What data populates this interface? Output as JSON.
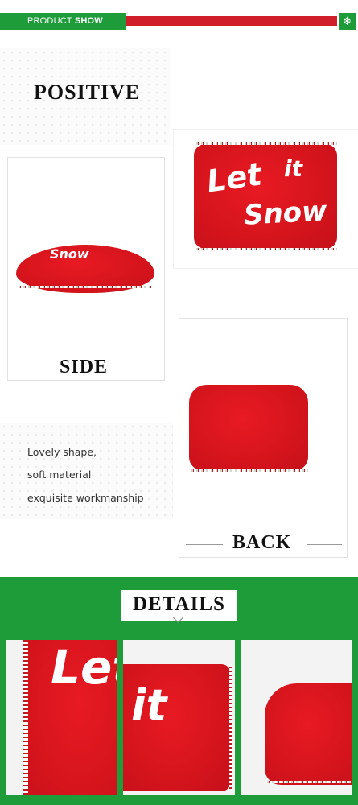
{
  "header": {
    "title_light": "PRODUCT",
    "title_bold": "SHOW",
    "snow_icon": "❄"
  },
  "sections": {
    "positive": "POSITIVE",
    "side": "SIDE",
    "back": "BACK",
    "details": "DETAILS"
  },
  "description": {
    "line1": "Lovely shape,",
    "line2": "soft material",
    "line3": "exquisite workmanship"
  },
  "pillow_text": {
    "let": "Let",
    "it": "it",
    "snow": "Snow"
  },
  "colors": {
    "brand_green": "#1e9c3a",
    "brand_red": "#d01f2b",
    "pillow_red": "#d5141c"
  }
}
